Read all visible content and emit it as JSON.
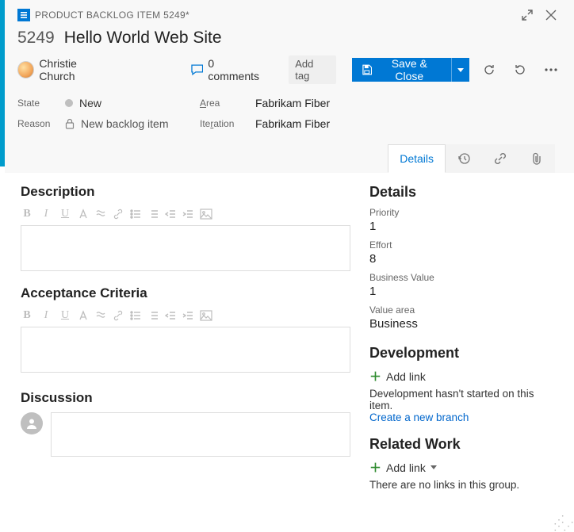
{
  "titlebar": {
    "breadcrumb": "PRODUCT BACKLOG ITEM 5249*"
  },
  "item": {
    "id": "5249",
    "title": "Hello World Web Site"
  },
  "assignee": {
    "name": "Christie Church"
  },
  "comments": {
    "count_label": "0 comments"
  },
  "tags": {
    "add_label": "Add tag"
  },
  "toolbar": {
    "save_label": "Save & Close"
  },
  "fields": {
    "state_label": "State",
    "state_value": "New",
    "area_label_pre": "A",
    "area_label_post": "rea",
    "area_value": "Fabrikam Fiber",
    "reason_label": "Reason",
    "reason_value": "New backlog item",
    "iteration_label_pre": "Ite",
    "iteration_label_post": "ation",
    "iteration_value": "Fabrikam Fiber"
  },
  "tabs": {
    "details": "Details"
  },
  "left": {
    "description": "Description",
    "acceptance": "Acceptance Criteria",
    "discussion": "Discussion"
  },
  "right": {
    "details_header": "Details",
    "priority_label": "Priority",
    "priority_value": "1",
    "effort_label": "Effort",
    "effort_value": "8",
    "bv_label": "Business Value",
    "bv_value": "1",
    "va_label": "Value area",
    "va_value": "Business",
    "dev_header": "Development",
    "addlink": "Add link",
    "dev_hint": "Development hasn't started on this item.",
    "dev_link": "Create a new branch",
    "rel_header": "Related Work",
    "rel_hint": "There are no links in this group."
  }
}
